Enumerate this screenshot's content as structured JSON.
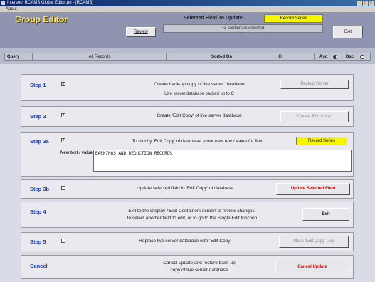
{
  "window": {
    "title": "Intersect RCAMS Global Editor.pe - [RCAMS]",
    "menu": [
      "About"
    ]
  },
  "header": {
    "app_title": "Group Editor",
    "review_label": "Review",
    "selected_field_label": "Selected Field To Update",
    "selected_field_value": "Record Series",
    "containers_selected": "43 containers selected",
    "exit_label": "Exit"
  },
  "query": {
    "query_label": "Query",
    "query_value": "All Records",
    "sorted_label": "Sorted On",
    "sorted_value": "ID",
    "asc_label": "Asc",
    "dsc_label": "Dsc"
  },
  "steps": {
    "step1": {
      "label": "Step 1",
      "checked": "x",
      "text": "Create back-up copy of live server database",
      "status": "Live server database backed up to C",
      "button": "Backup Server"
    },
    "step2": {
      "label": "Step 2",
      "checked": "x",
      "text": "Create 'Edit Copy' of live server database",
      "button": "Create 'Edit Copy'"
    },
    "step3a": {
      "label": "Step 3a",
      "checked": "x",
      "text": "To modify 'Edit Copy' of database, enter new text / value for field",
      "field": "Record Series",
      "new_value_label": "New text / value",
      "new_value": "EARNINGS AND DEDUCTION RECORDS"
    },
    "step3b": {
      "label": "Step 3b",
      "checked": "",
      "text": "Update selected field in 'Edit Copy' of database",
      "button": "Update Selected Field"
    },
    "step4": {
      "label": "Step 4",
      "text1": "Exit to the Display / Edit Containers screen to review changes,",
      "text2": "to select another field to edit, or to go to the Single Edit function",
      "button": "Exit"
    },
    "step5": {
      "label": "Step 5",
      "checked": "",
      "text": "Replace live server database with 'Edit Copy'",
      "button": "Make 'Edit Copy' Live"
    },
    "cancel": {
      "label": "Cancel",
      "text1": "Cancel update and restore back-up",
      "text2": "copy of live server database",
      "button": "Cancel Update"
    }
  }
}
